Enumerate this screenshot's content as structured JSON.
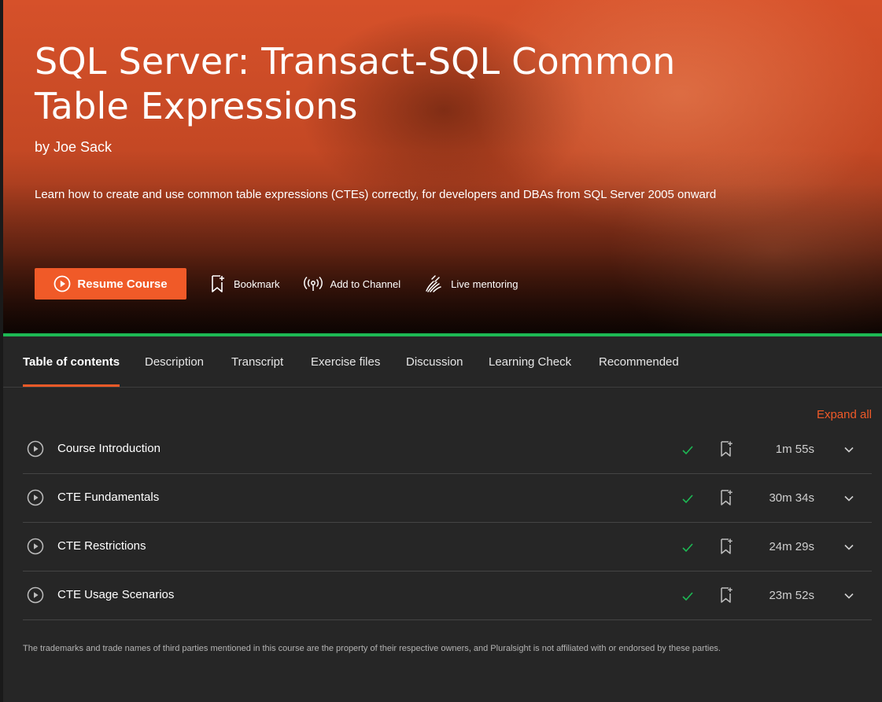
{
  "course": {
    "title": "SQL Server: Transact-SQL Common Table Expressions",
    "author": "by Joe Sack",
    "description": "Learn how to create and use common table expressions (CTEs) correctly, for developers and DBAs from SQL Server 2005 onward"
  },
  "actions": {
    "resume_label": "Resume Course",
    "bookmark_label": "Bookmark",
    "channel_label": "Add to Channel",
    "mentoring_label": "Live mentoring"
  },
  "tabs": [
    {
      "label": "Table of contents",
      "active": true
    },
    {
      "label": "Description"
    },
    {
      "label": "Transcript"
    },
    {
      "label": "Exercise files"
    },
    {
      "label": "Discussion"
    },
    {
      "label": "Learning Check"
    },
    {
      "label": "Recommended"
    }
  ],
  "toc": {
    "expand_all_label": "Expand all",
    "modules": [
      {
        "title": "Course Introduction",
        "duration": "1m 55s",
        "completed": true
      },
      {
        "title": "CTE Fundamentals",
        "duration": "30m 34s",
        "completed": true
      },
      {
        "title": "CTE Restrictions",
        "duration": "24m 29s",
        "completed": true
      },
      {
        "title": "CTE Usage Scenarios",
        "duration": "23m 52s",
        "completed": true
      }
    ]
  },
  "footer": {
    "disclaimer": "The trademarks and trade names of third parties mentioned in this course are the property of their respective owners, and Pluralsight is not affiliated with or endorsed by these parties."
  },
  "colors": {
    "accent": "#f05a28",
    "success": "#1db954",
    "background": "#262626"
  },
  "icons": {
    "resume": "play-circle-icon",
    "bookmark": "bookmark-icon",
    "channel": "broadcast-icon",
    "mentoring": "mentoring-hand-icon",
    "module_play": "play-circle-icon",
    "module_complete": "check-icon",
    "module_bookmark": "bookmark-plus-icon",
    "module_expand": "chevron-down-icon"
  }
}
